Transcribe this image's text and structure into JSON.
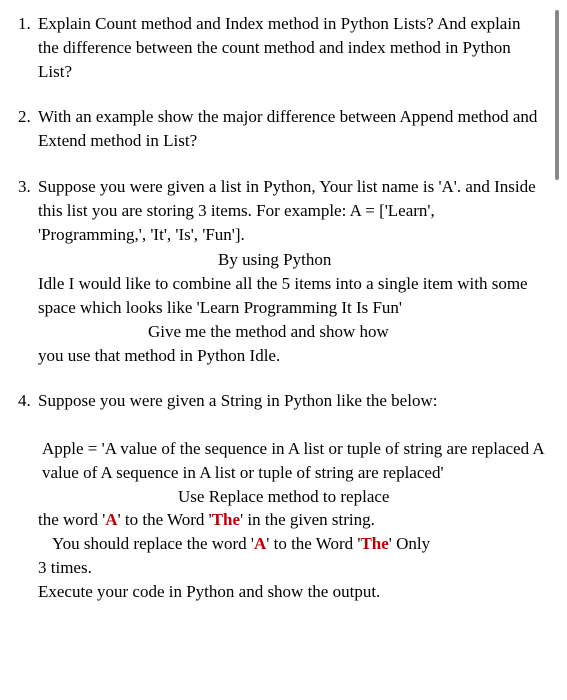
{
  "questions": [
    {
      "text": "Explain Count method and Index method in Python Lists? And explain the difference between the count method and index method in Python List?"
    },
    {
      "text": "With an example show the major difference between Append method and Extend method in List?"
    },
    {
      "p1": "Suppose you were given a list in Python, Your list name is 'A'. and Inside this list you are storing 3 items. For example: A = ['Learn', 'Programming,', 'It', 'Is', 'Fun'].",
      "p2_right": "By using Python",
      "p2_cont": "Idle I would like to combine all the 5 items into a single item with some space which looks like 'Learn Programming It Is Fun'",
      "p3_center": "Give me the method and show how",
      "p3_cont": "you use that method in Python Idle."
    },
    {
      "p1": "Suppose you were given a String in Python like the below:",
      "p2": "Apple = 'A value of the sequence in A list or tuple of string are replaced A value of A sequence in A list or tuple of string are replaced'",
      "p3_center": "Use Replace method to replace",
      "p3_cont_a": "the word '",
      "p3_A": "A",
      "p3_cont_b": "' to the Word '",
      "p3_The": "The",
      "p3_cont_c": "' in the given string.",
      "p4_a": "You should replace the word '",
      "p4_A": "A",
      "p4_b": "' to the Word '",
      "p4_The": "The",
      "p4_c": "' Only",
      "p4_cont": "3 times.",
      "p5": "Execute your code in Python and show the output."
    }
  ]
}
